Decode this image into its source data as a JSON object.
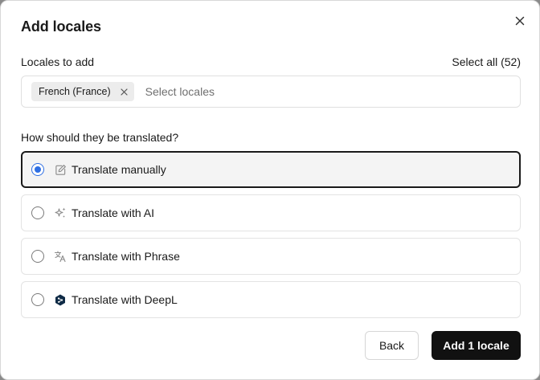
{
  "dialog": {
    "title": "Add locales",
    "close_icon": "close-icon"
  },
  "locales": {
    "label": "Locales to add",
    "select_all": "Select all (52)",
    "chips": [
      {
        "label": "French (France)",
        "remove_icon": "x-icon"
      }
    ],
    "placeholder": "Select locales"
  },
  "translation": {
    "question": "How should they be translated?",
    "selected_index": 0,
    "options": [
      {
        "label": "Translate manually",
        "icon": "pencil-icon",
        "selected": true
      },
      {
        "label": "Translate with AI",
        "icon": "sparkles-icon",
        "selected": false
      },
      {
        "label": "Translate with Phrase",
        "icon": "translate-icon",
        "selected": false
      },
      {
        "label": "Translate with DeepL",
        "icon": "deepl-icon",
        "selected": false
      }
    ]
  },
  "footer": {
    "back_label": "Back",
    "add_label": "Add 1 locale"
  },
  "colors": {
    "accent": "#2f6fe3",
    "primary_button": "#111111",
    "deepl_icon": "#0f2b46"
  }
}
